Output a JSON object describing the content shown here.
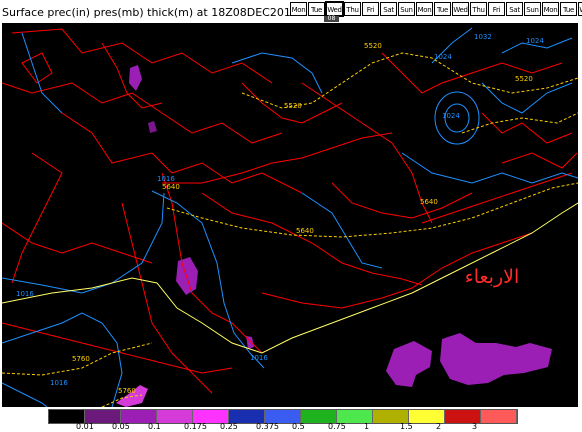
{
  "title": "Surface prec(in) pres(mb) thick(m) at 18Z08DEC2010",
  "day_selector": {
    "days": [
      "Mon",
      "Tue",
      "Wed",
      "Thu",
      "Fri",
      "Sat",
      "Sun",
      "Mon",
      "Tue",
      "Wed",
      "Thu",
      "Fri",
      "Sat",
      "Sun",
      "Mon",
      "Tue",
      "Wed"
    ],
    "selected_index": 2,
    "selected_date_label": "08"
  },
  "map": {
    "arabic_label": "الاربعاء",
    "isobar_labels": [
      "1016",
      "1016",
      "1016",
      "1016",
      "1024",
      "1024",
      "1032",
      "1024"
    ],
    "thickness_labels": [
      "5520",
      "5520",
      "5520",
      "5640",
      "5640",
      "5640",
      "5760",
      "5760"
    ],
    "colors": {
      "background": "#000000",
      "borders": "#ff0000",
      "isobars": "#1e90ff",
      "thickness": "#ffd000",
      "thickness_main": "#ffff66",
      "arabic_text": "#ff2a2a",
      "precip": "#9b1fb5"
    }
  },
  "legend": {
    "colors": [
      "#000000",
      "#6b1a7c",
      "#9b1fb5",
      "#d43bd8",
      "#ff33ff",
      "#1a2fb0",
      "#3b5cf0",
      "#1fb21f",
      "#4ee84e",
      "#b0b000",
      "#ffff33",
      "#cc1111",
      "#ff5a5a"
    ],
    "labels": [
      "0.01",
      "0.05",
      "0.1",
      "0.175",
      "0.25",
      "0.375",
      "0.5",
      "0.75",
      "1",
      "1.5",
      "2",
      "3"
    ]
  }
}
